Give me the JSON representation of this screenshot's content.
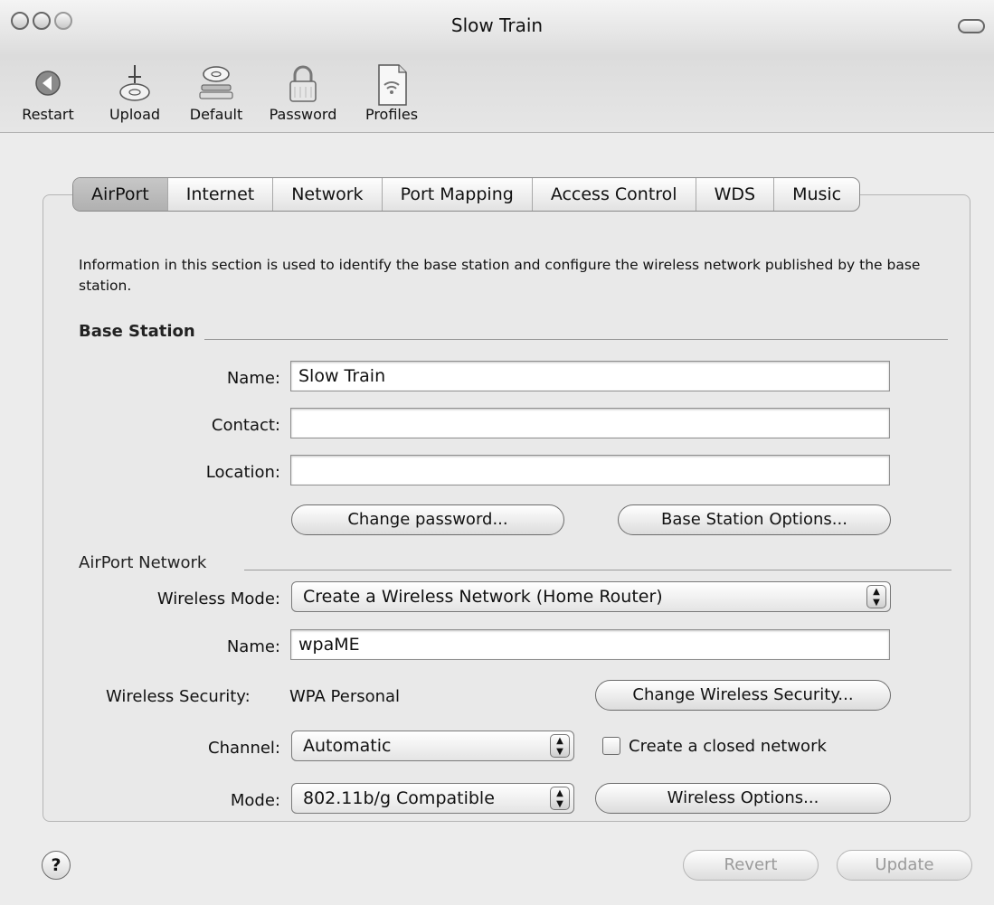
{
  "window": {
    "title": "Slow Train"
  },
  "toolbar": {
    "items": [
      {
        "label": "Restart",
        "icon": "restart-icon"
      },
      {
        "label": "Upload",
        "icon": "upload-icon"
      },
      {
        "label": "Default",
        "icon": "default-icon"
      },
      {
        "label": "Password",
        "icon": "lock-icon"
      },
      {
        "label": "Profiles",
        "icon": "profiles-icon"
      }
    ]
  },
  "tabs": [
    {
      "label": "AirPort",
      "active": true
    },
    {
      "label": "Internet"
    },
    {
      "label": "Network"
    },
    {
      "label": "Port Mapping"
    },
    {
      "label": "Access Control"
    },
    {
      "label": "WDS"
    },
    {
      "label": "Music"
    }
  ],
  "info_text": "Information in this section is used to identify the base station and configure the wireless network published by the base station.",
  "base_station": {
    "heading": "Base Station",
    "name_label": "Name:",
    "name_value": "Slow Train",
    "contact_label": "Contact:",
    "contact_value": "",
    "location_label": "Location:",
    "location_value": "",
    "change_password_button": "Change password...",
    "options_button": "Base Station Options..."
  },
  "airport_network": {
    "heading": "AirPort Network",
    "wireless_mode_label": "Wireless Mode:",
    "wireless_mode_value": "Create a Wireless Network (Home Router)",
    "name_label": "Name:",
    "name_value": "wpaME",
    "security_label": "Wireless Security:",
    "security_value": "WPA Personal",
    "change_security_button": "Change Wireless Security...",
    "channel_label": "Channel:",
    "channel_value": "Automatic",
    "closed_network_label": "Create a closed network",
    "closed_network_checked": false,
    "mode_label": "Mode:",
    "mode_value": "802.11b/g Compatible",
    "wireless_options_button": "Wireless Options..."
  },
  "footer": {
    "help": "?",
    "revert_button": "Revert",
    "update_button": "Update"
  }
}
